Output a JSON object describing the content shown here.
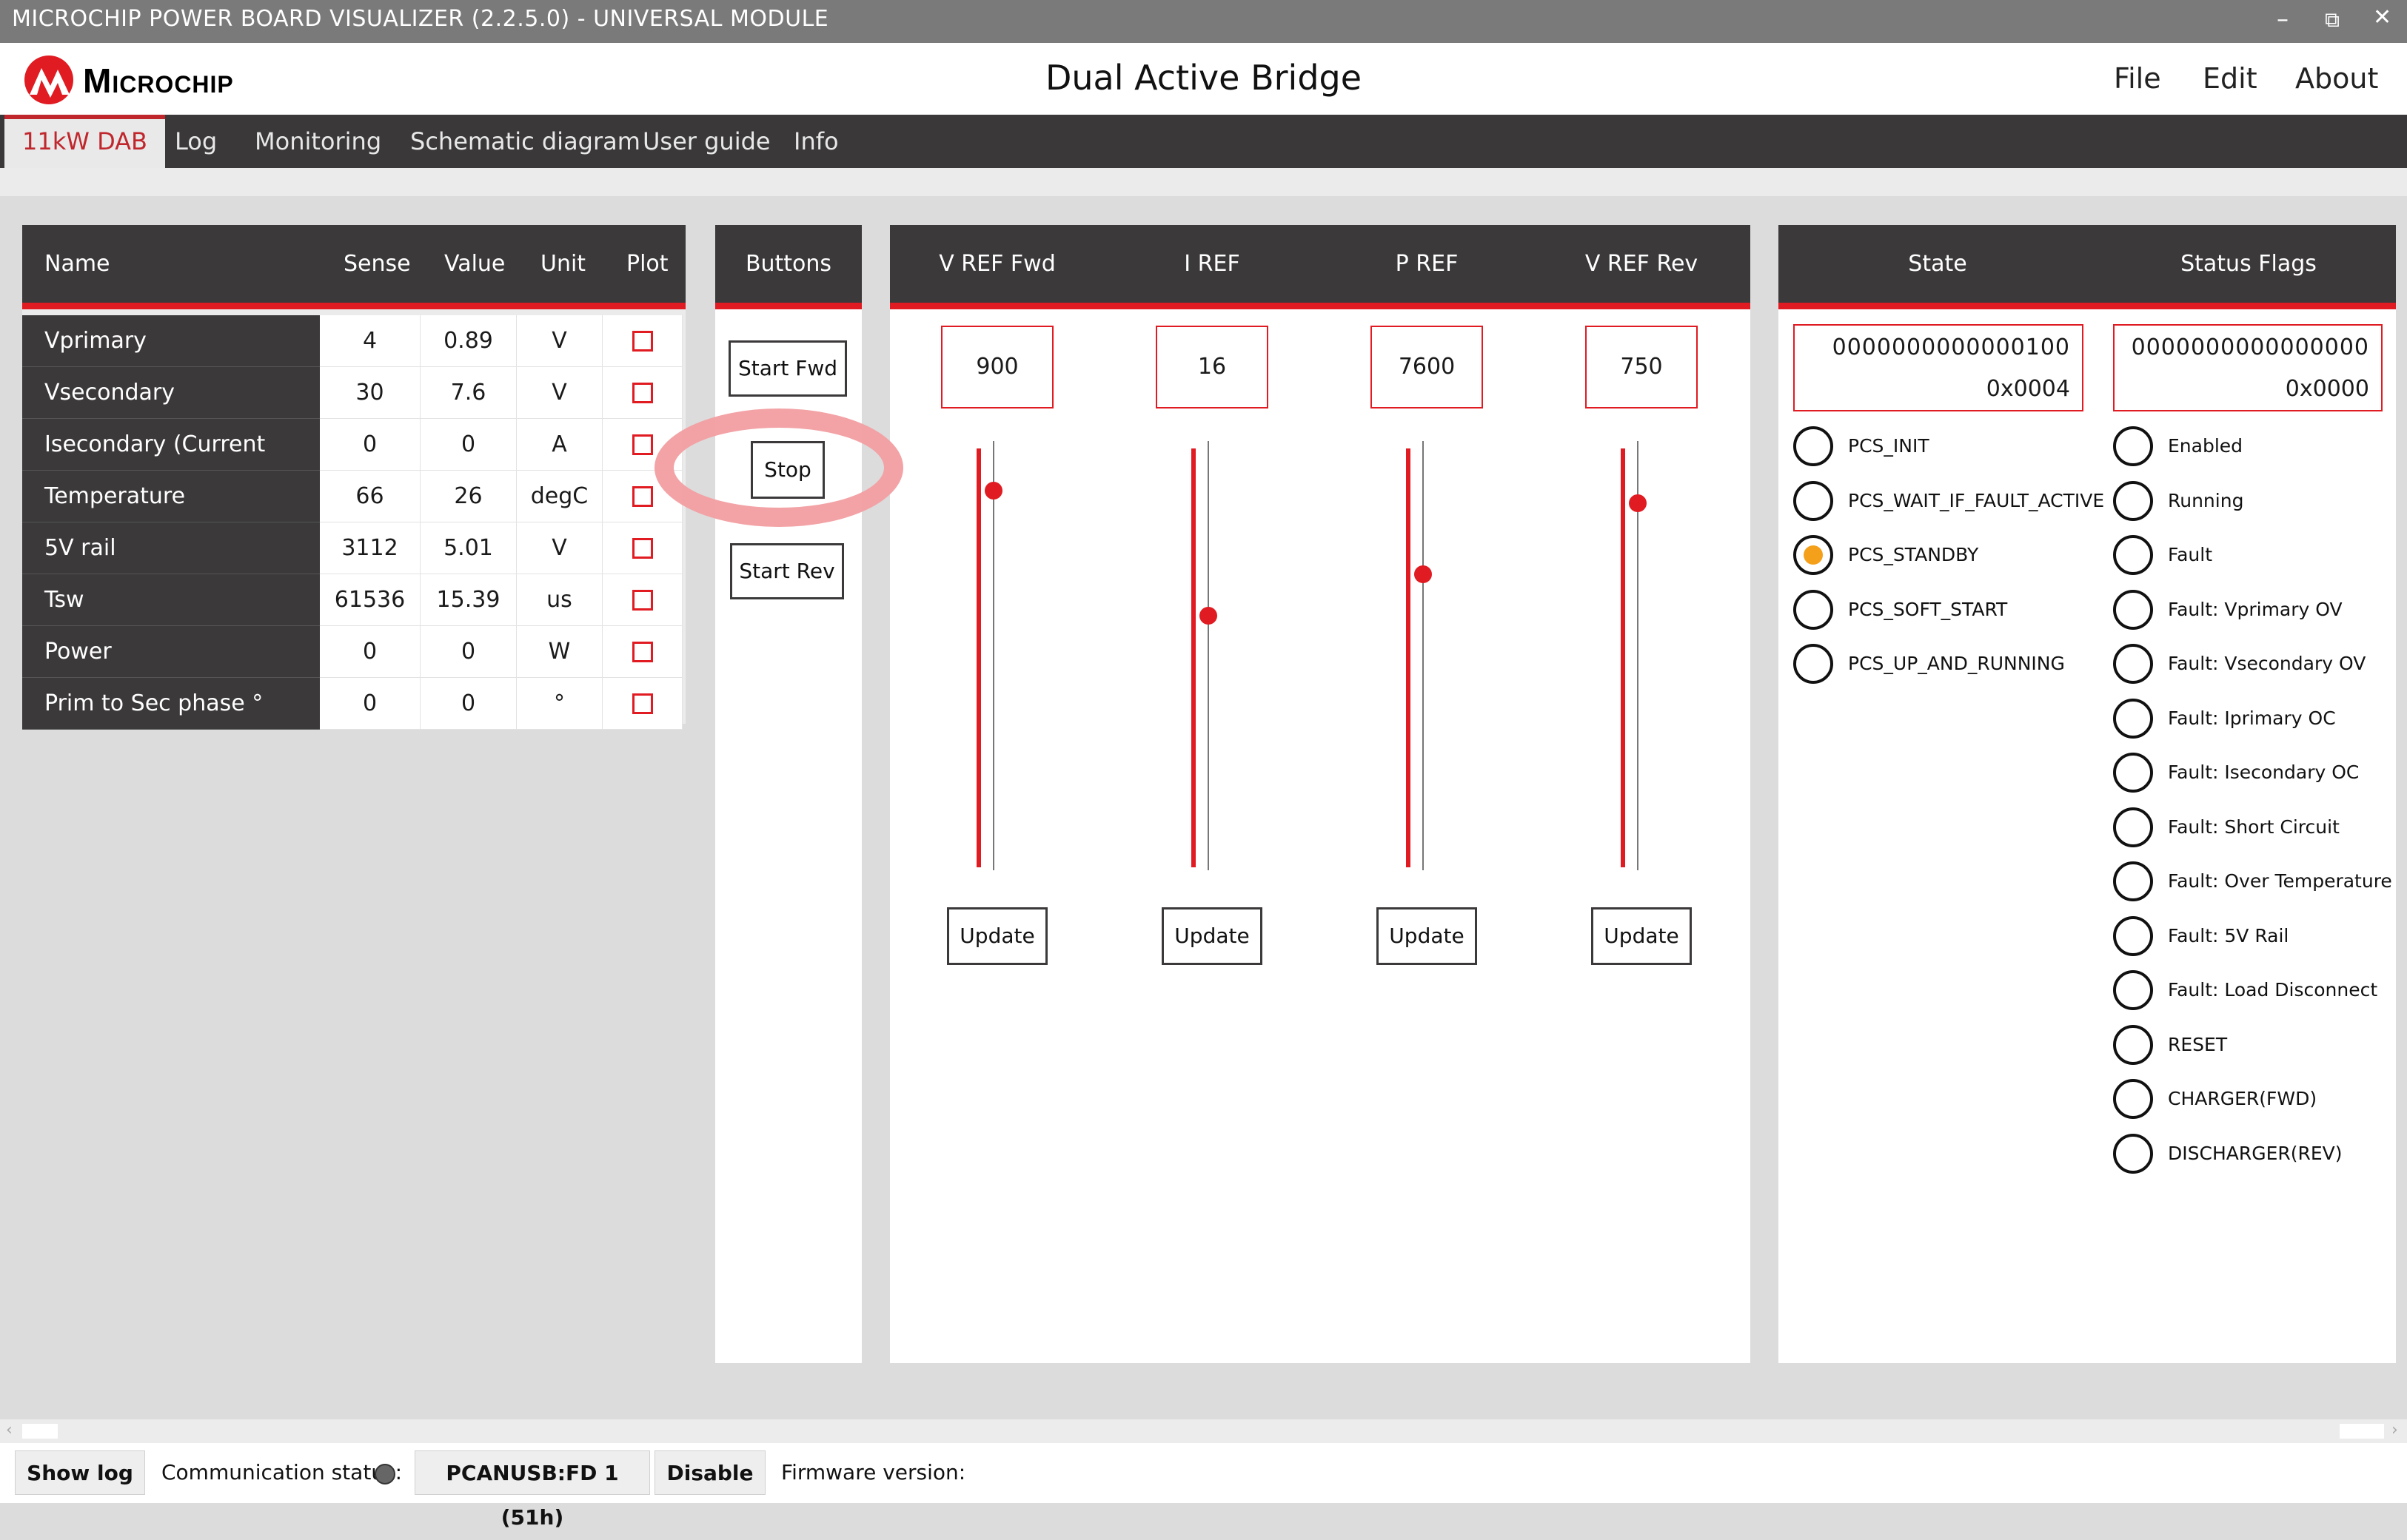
{
  "window": {
    "title": "MICROCHIP POWER BOARD VISUALIZER (2.2.5.0) - UNIVERSAL MODULE",
    "minimize_glyph": "–",
    "restore_glyph": "⧉",
    "close_glyph": "✕"
  },
  "header": {
    "logo_text": "Microchip",
    "app_title": "Dual Active Bridge",
    "menu": [
      "File",
      "Edit",
      "About"
    ]
  },
  "tabs": [
    "11kW DAB",
    "Log",
    "Monitoring",
    "Schematic diagram",
    "User guide",
    "Info"
  ],
  "active_tab": 0,
  "table": {
    "headers": [
      "Name",
      "Sense",
      "Value",
      "Unit",
      "Plot"
    ],
    "rows": [
      {
        "name": "Vprimary",
        "sense": "4",
        "value": "0.89",
        "unit": "V"
      },
      {
        "name": "Vsecondary",
        "sense": "30",
        "value": "7.6",
        "unit": "V"
      },
      {
        "name": "Isecondary (Current Sensor)",
        "sense": "0",
        "value": "0",
        "unit": "A"
      },
      {
        "name": "Temperature",
        "sense": "66",
        "value": "26",
        "unit": "degC"
      },
      {
        "name": "5V rail",
        "sense": "3112",
        "value": "5.01",
        "unit": "V"
      },
      {
        "name": "Tsw",
        "sense": "61536",
        "value": "15.39",
        "unit": "us"
      },
      {
        "name": "Power",
        "sense": "0",
        "value": "0",
        "unit": "W"
      },
      {
        "name": "Prim to Sec phase °",
        "sense": "0",
        "value": "0",
        "unit": "°"
      }
    ]
  },
  "buttons_panel": {
    "header": "Buttons",
    "start_fwd": "Start Fwd",
    "stop": "Stop",
    "start_rev": "Start Rev"
  },
  "refs": [
    {
      "header": "V REF Fwd",
      "value": "900",
      "slider_fraction": 0.9,
      "update": "Update"
    },
    {
      "header": "I REF",
      "value": "16",
      "slider_fraction": 0.6,
      "update": "Update"
    },
    {
      "header": "P REF",
      "value": "7600",
      "slider_fraction": 0.7,
      "update": "Update"
    },
    {
      "header": "V REF Rev",
      "value": "750",
      "slider_fraction": 0.87,
      "update": "Update"
    }
  ],
  "state": {
    "header": "State",
    "binary": "0000000000000100",
    "hex": "0x0004",
    "items": [
      {
        "label": "PCS_INIT",
        "active": false
      },
      {
        "label": "PCS_WAIT_IF_FAULT_ACTIVE",
        "active": false
      },
      {
        "label": "PCS_STANDBY",
        "active": true
      },
      {
        "label": "PCS_SOFT_START",
        "active": false
      },
      {
        "label": "PCS_UP_AND_RUNNING",
        "active": false
      }
    ],
    "active_color": "#f5a01a"
  },
  "status_flags": {
    "header": "Status Flags",
    "binary": "0000000000000000",
    "hex": "0x0000",
    "items": [
      "Enabled",
      "Running",
      "Fault",
      "Fault: Vprimary OV",
      "Fault: Vsecondary OV",
      "Fault: Iprimary OC",
      "Fault: Isecondary OC",
      "Fault: Short Circuit",
      "Fault: Over Temperature",
      "Fault: 5V Rail",
      "Fault: Load Disconnect",
      "RESET",
      "CHARGER(FWD)",
      "DISCHARGER(REV)"
    ]
  },
  "statusbar": {
    "show_log": "Show log",
    "comm_label": "Communication status:",
    "device": "PCANUSB:FD 1 (51h)",
    "disable": "Disable",
    "firmware_label": "Firmware version:"
  },
  "colors": {
    "accent": "#e01b22",
    "dark": "#3b3939",
    "highlight": "#f29ea1"
  }
}
